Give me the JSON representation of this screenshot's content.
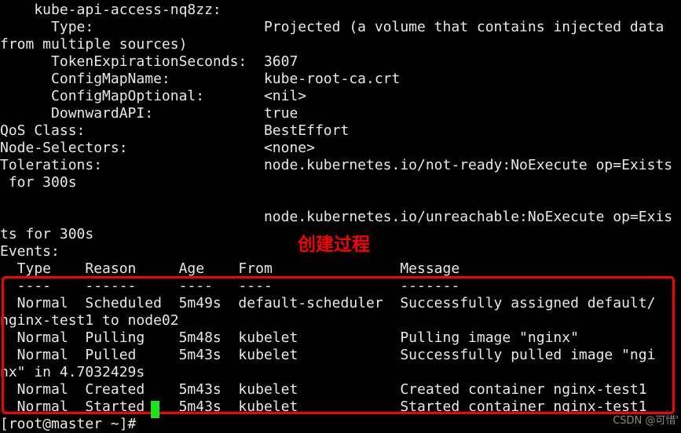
{
  "terminal": {
    "background_color": "#000000",
    "foreground_color": "#e8e8e8",
    "annotation_color": "#fb0000",
    "cursor_color": "#19e619",
    "lines": [
      "    kube-api-access-nq8zz:",
      "      Type:                    Projected (a volume that contains injected data",
      "from multiple sources)",
      "      TokenExpirationSeconds:  3607",
      "      ConfigMapName:           kube-root-ca.crt",
      "      ConfigMapOptional:       <nil>",
      "      DownwardAPI:             true",
      "QoS Class:                     BestEffort",
      "Node-Selectors:                <none>",
      "Tolerations:                   node.kubernetes.io/not-ready:NoExecute op=Exists",
      " for 300s",
      "",
      "                               node.kubernetes.io/unreachable:NoExecute op=Exis",
      "ts for 300s",
      "Events:",
      "  Type    Reason     Age    From               Message",
      "  ----    ------     ----   ----               -------",
      "  Normal  Scheduled  5m49s  default-scheduler  Successfully assigned default/",
      "nginx-test1 to node02",
      "  Normal  Pulling    5m48s  kubelet            Pulling image \"nginx\"",
      "  Normal  Pulled     5m43s  kubelet            Successfully pulled image \"ngi",
      "nx\" in 4.7032429s",
      "  Normal  Created    5m43s  kubelet            Created container nginx-test1",
      "  Normal  Started    5m43s  kubelet            Started container nginx-test1",
      "[root@master ~]# "
    ]
  },
  "volume_details": {
    "name": "kube-api-access-nq8zz:",
    "fields": [
      {
        "label": "Type:",
        "value": "Projected (a volume that contains injected data from multiple sources)"
      },
      {
        "label": "TokenExpirationSeconds:",
        "value": "3607"
      },
      {
        "label": "ConfigMapName:",
        "value": "kube-root-ca.crt"
      },
      {
        "label": "ConfigMapOptional:",
        "value": "<nil>"
      },
      {
        "label": "DownwardAPI:",
        "value": "true"
      }
    ]
  },
  "pod_summary": {
    "qos_class_label": "QoS Class:",
    "qos_class_value": "BestEffort",
    "node_selectors_label": "Node-Selectors:",
    "node_selectors_value": "<none>",
    "tolerations_label": "Tolerations:",
    "tolerations_values": [
      "node.kubernetes.io/not-ready:NoExecute op=Exists for 300s",
      "node.kubernetes.io/unreachable:NoExecute op=Exists for 300s"
    ]
  },
  "events": {
    "section_label": "Events:",
    "columns": [
      "Type",
      "Reason",
      "Age",
      "From",
      "Message"
    ],
    "column_rules": [
      "----",
      "------",
      "----",
      "----",
      "-------"
    ],
    "rows": [
      {
        "type": "Normal",
        "reason": "Scheduled",
        "age": "5m49s",
        "from": "default-scheduler",
        "message": "Successfully assigned default/nginx-test1 to node02"
      },
      {
        "type": "Normal",
        "reason": "Pulling",
        "age": "5m48s",
        "from": "kubelet",
        "message": "Pulling image \"nginx\""
      },
      {
        "type": "Normal",
        "reason": "Pulled",
        "age": "5m43s",
        "from": "kubelet",
        "message": "Successfully pulled image \"nginx\" in 4.7032429s"
      },
      {
        "type": "Normal",
        "reason": "Created",
        "age": "5m43s",
        "from": "kubelet",
        "message": "Created container nginx-test1"
      },
      {
        "type": "Normal",
        "reason": "Started",
        "age": "5m43s",
        "from": "kubelet",
        "message": "Started container nginx-test1"
      }
    ]
  },
  "annotation": {
    "label": "创建过程",
    "color": "#fb0000",
    "box_color": "#fb0000"
  },
  "prompt": {
    "text": "[root@master ~]#",
    "cursor": "block"
  },
  "watermark": {
    "text": "CSDN @可惜'"
  }
}
